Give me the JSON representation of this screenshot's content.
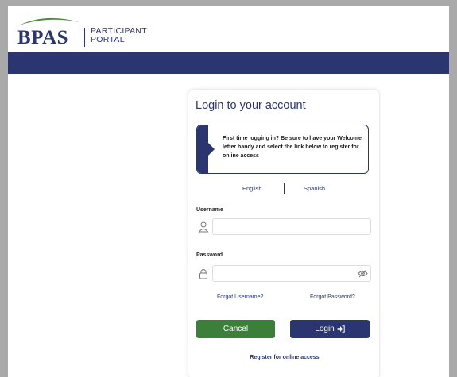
{
  "header": {
    "logo_text": "BPAS",
    "portal_line1": "PARTICIPANT",
    "portal_line2": "PORTAL"
  },
  "login": {
    "title": "Login to your account",
    "info_message": "First time logging in? Be sure to have your Welcome letter handy and select the link below to register for online access",
    "languages": [
      "English",
      "Spanish"
    ],
    "username_label": "Username",
    "username_value": "",
    "password_label": "Password",
    "password_value": "",
    "forgot_username": "Forgot Username?",
    "forgot_password": "Forgot Password?",
    "cancel_label": "Cancel",
    "login_label": "Login",
    "register_link": "Register for online access"
  },
  "icons": {
    "username": "user-icon",
    "password": "lock-icon",
    "visibility": "eye-slash-icon",
    "login": "sign-in-icon"
  },
  "colors": {
    "brand_navy": "#2b3570",
    "cancel_green": "#3c7f3b",
    "logo_green": "#4a8c3c"
  }
}
